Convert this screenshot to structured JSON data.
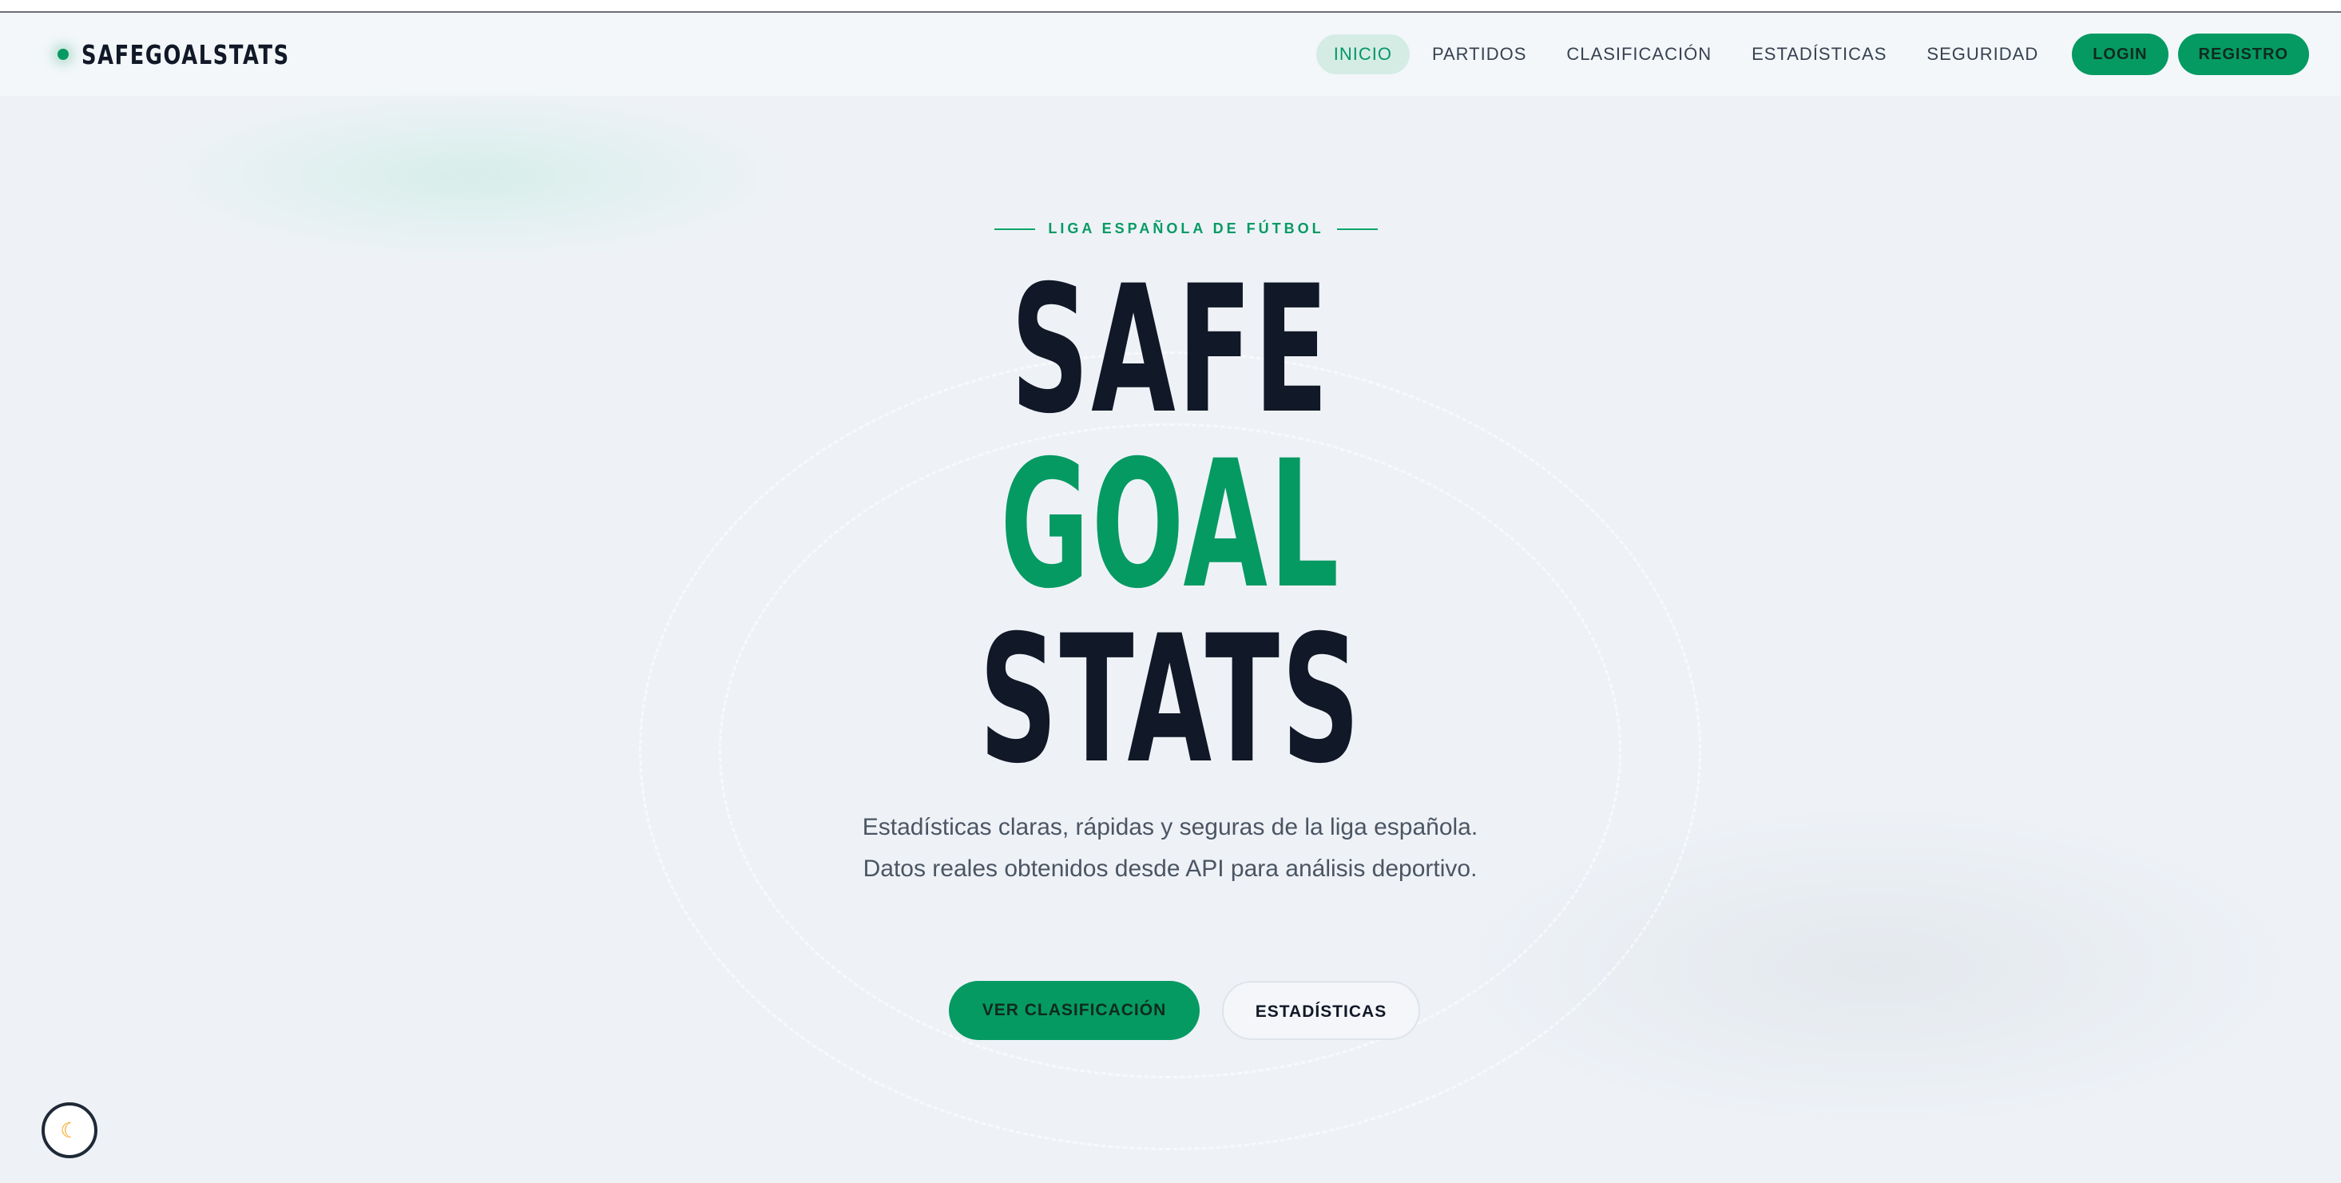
{
  "nav": {
    "brand": "SAFEGOALSTATS",
    "links": [
      {
        "label": "INICIO",
        "active": true
      },
      {
        "label": "PARTIDOS",
        "active": false
      },
      {
        "label": "CLASIFICACIÓN",
        "active": false
      },
      {
        "label": "ESTADÍSTICAS",
        "active": false
      },
      {
        "label": "SEGURIDAD",
        "active": false
      }
    ],
    "login_label": "LOGIN",
    "register_label": "REGISTRO"
  },
  "hero": {
    "eyebrow": "LIGA ESPAÑOLA DE FÚTBOL",
    "title_lines": [
      "SAFE",
      "GOAL",
      "STATS"
    ],
    "description": "Estadísticas claras, rápidas y seguras de la liga española. Datos reales obtenidos desde API para análisis deportivo.",
    "primary_cta": "VER CLASIFICACIÓN",
    "secondary_cta": "ESTADÍSTICAS"
  },
  "colors": {
    "accent": "#069a63",
    "background": "#eef2f7",
    "text_dark": "#111827"
  },
  "icons": {
    "brand": "dot-icon",
    "theme_toggle": "moon-icon"
  }
}
